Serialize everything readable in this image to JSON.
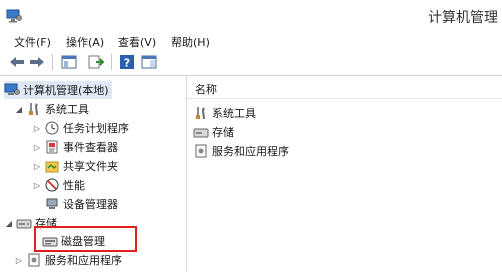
{
  "window": {
    "title": "计算机管理"
  },
  "menu": [
    {
      "label": "文件(F)"
    },
    {
      "label": "操作(A)"
    },
    {
      "label": "查看(V)"
    },
    {
      "label": "帮助(H)"
    }
  ],
  "toolbar": {
    "buttons": [
      "back-icon",
      "forward-icon",
      "show-hide-tree-icon",
      "export-list-icon",
      "help-icon",
      "properties-icon"
    ]
  },
  "tree": {
    "root": "计算机管理(本地)",
    "system_tools": "系统工具",
    "task_scheduler": "任务计划程序",
    "event_viewer": "事件查看器",
    "shared_folders": "共享文件夹",
    "performance": "性能",
    "device_manager": "设备管理器",
    "storage": "存储",
    "disk_management": "磁盘管理",
    "services_apps": "服务和应用程序"
  },
  "list": {
    "header": "名称",
    "rows": [
      {
        "label": "系统工具",
        "icon": "tools-icon"
      },
      {
        "label": "存储",
        "icon": "storage-icon"
      },
      {
        "label": "服务和应用程序",
        "icon": "services-icon"
      }
    ]
  },
  "colors": {
    "highlight": "#e02020",
    "accent": "#1e5aa8"
  }
}
